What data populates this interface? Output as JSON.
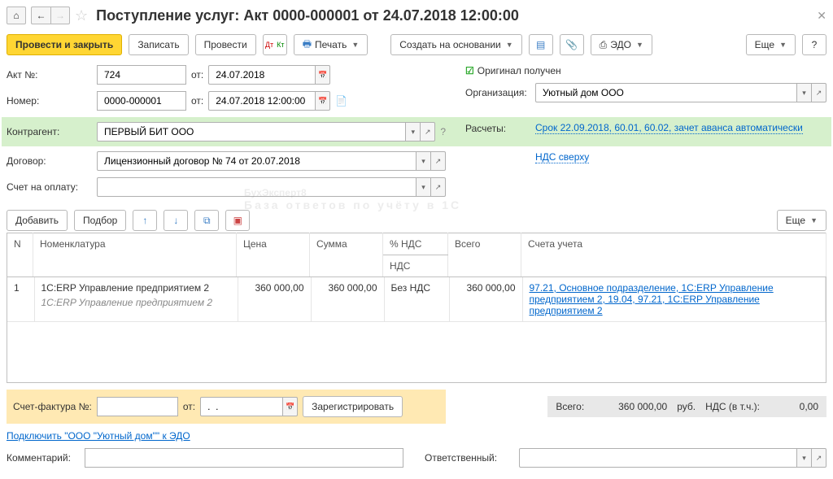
{
  "title": "Поступление услуг: Акт 0000-000001 от 24.07.2018 12:00:00",
  "toolbar": {
    "post_close": "Провести и закрыть",
    "write": "Записать",
    "post": "Провести",
    "print": "Печать",
    "create_from": "Создать на основании",
    "edo": "ЭДО",
    "more": "Еще"
  },
  "fields": {
    "act_no_label": "Акт №:",
    "act_no": "724",
    "from": "от:",
    "act_date": "24.07.2018",
    "number_label": "Номер:",
    "number": "0000-000001",
    "doc_date": "24.07.2018 12:00:00",
    "original_received": "Оригинал получен",
    "org_label": "Организация:",
    "org": "Уютный дом ООО",
    "counterparty_label": "Контрагент:",
    "counterparty": "ПЕРВЫЙ БИТ ООО",
    "settlements_label": "Расчеты:",
    "settlements_link": "Срок 22.09.2018, 60.01, 60.02, зачет аванса автоматически",
    "contract_label": "Договор:",
    "contract": "Лицензионный договор № 74 от 20.07.2018",
    "vat_mode_link": "НДС сверху",
    "invoice_acc_label": "Счет на оплату:",
    "invoice_acc": ""
  },
  "table_toolbar": {
    "add": "Добавить",
    "select": "Подбор",
    "more": "Еще"
  },
  "table": {
    "headers": {
      "n": "N",
      "nomenclature": "Номенклатура",
      "price": "Цена",
      "sum": "Сумма",
      "vat_pct": "% НДС",
      "vat": "НДС",
      "total": "Всего",
      "accounts": "Счета учета"
    },
    "row": {
      "n": "1",
      "name": "1С:ERP Управление предприятием 2",
      "name_sub": "1С:ERP Управление предприятием 2",
      "price": "360 000,00",
      "sum": "360 000,00",
      "vat_pct": "Без НДС",
      "total": "360 000,00",
      "accounts": "97.21, Основное подразделение, 1С:ERP Управление предприятием 2, 19.04, 97.21, 1С:ERP Управление предприятием 2"
    }
  },
  "invoice": {
    "label": "Счет-фактура №:",
    "no": "",
    "from": "от:",
    "date": ".  .",
    "register": "Зарегистрировать"
  },
  "totals": {
    "total_label": "Всего:",
    "total": "360 000,00",
    "currency": "руб.",
    "vat_label": "НДС (в т.ч.):",
    "vat": "0,00"
  },
  "edo_link": "Подключить \"ООО \"Уютный дом\"\" к ЭДО",
  "footer": {
    "comment_label": "Комментарий:",
    "responsible_label": "Ответственный:"
  },
  "watermark": {
    "main": "БухЭксперт8",
    "sub": "База ответов по учёту в 1С"
  }
}
